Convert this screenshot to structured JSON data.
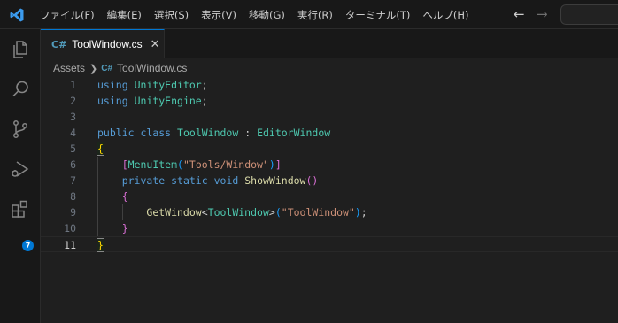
{
  "menubar": {
    "items": [
      "ファイル(F)",
      "編集(E)",
      "選択(S)",
      "表示(V)",
      "移動(G)",
      "実行(R)",
      "ターミナル(T)",
      "ヘルプ(H)"
    ]
  },
  "navigation": {
    "back_icon": "arrow-left-icon",
    "forward_icon": "arrow-right-icon"
  },
  "activitybar": {
    "items": [
      "explorer-icon",
      "search-icon",
      "source-control-icon",
      "run-debug-icon",
      "extensions-icon"
    ],
    "extensions_badge": "7"
  },
  "tabs": [
    {
      "label": "ToolWindow.cs",
      "icon": "C#",
      "active": true
    }
  ],
  "breadcrumb": {
    "folder": "Assets",
    "file": "ToolWindow.cs",
    "file_icon": "C#"
  },
  "editor": {
    "current_line": 11,
    "lines": [
      {
        "number": "1",
        "text": "using UnityEditor;"
      },
      {
        "number": "2",
        "text": "using UnityEngine;"
      },
      {
        "number": "3",
        "text": ""
      },
      {
        "number": "4",
        "text": "public class ToolWindow : EditorWindow"
      },
      {
        "number": "5",
        "text": "{"
      },
      {
        "number": "6",
        "text": "    [MenuItem(\"Tools/Window\")]"
      },
      {
        "number": "7",
        "text": "    private static void ShowWindow()"
      },
      {
        "number": "8",
        "text": "    {"
      },
      {
        "number": "9",
        "text": "        GetWindow<ToolWindow>(\"ToolWindow\");"
      },
      {
        "number": "10",
        "text": "    }"
      },
      {
        "number": "11",
        "text": "}"
      }
    ]
  },
  "colors": {
    "accent": "#0078d4",
    "keyword": "#569cd6",
    "type": "#4ec9b0",
    "function": "#dcdcaa",
    "string": "#ce9178",
    "bracket_level1": "#ffd700",
    "bracket_level2": "#da70d6",
    "bracket_level3": "#179fff"
  }
}
